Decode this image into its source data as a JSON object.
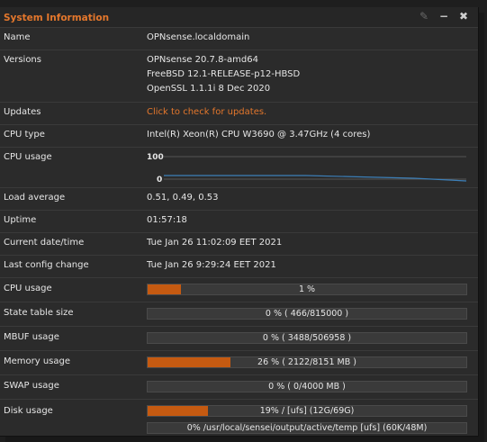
{
  "widget": {
    "title": "System Information"
  },
  "icons": {
    "edit": "pencil-icon",
    "minimize": "minus-icon",
    "close": "close-icon"
  },
  "rows": {
    "name": {
      "label": "Name",
      "value": "OPNsense.localdomain"
    },
    "versions": {
      "label": "Versions",
      "lines": [
        "OPNsense 20.7.8-amd64",
        "FreeBSD 12.1-RELEASE-p12-HBSD",
        "OpenSSL 1.1.1i 8 Dec 2020"
      ]
    },
    "updates": {
      "label": "Updates",
      "link": "Click to check for updates."
    },
    "cpu_type": {
      "label": "CPU type",
      "value": "Intel(R) Xeon(R) CPU W3690 @ 3.47GHz (4 cores)"
    },
    "cpu_graph": {
      "label": "CPU usage",
      "y_max": "100",
      "y_min": "0"
    },
    "load": {
      "label": "Load average",
      "value": "0.51, 0.49, 0.53"
    },
    "uptime": {
      "label": "Uptime",
      "value": "01:57:18"
    },
    "date": {
      "label": "Current date/time",
      "value": "Tue Jan 26 11:02:09 EET 2021"
    },
    "config": {
      "label": "Last config change",
      "value": "Tue Jan 26 9:29:24 EET 2021"
    }
  },
  "bars": {
    "cpu": {
      "label": "CPU usage",
      "text": "1 %",
      "fraction": 0.105
    },
    "state": {
      "label": "State table size",
      "text": "0 % ( 466/815000 )",
      "fraction": 0.0
    },
    "mbuf": {
      "label": "MBUF usage",
      "text": "0 % ( 3488/506958 )",
      "fraction": 0.0
    },
    "memory": {
      "label": "Memory usage",
      "text": "26 % ( 2122/8151 MB )",
      "fraction": 0.26
    },
    "swap": {
      "label": "SWAP usage",
      "text": "0 % ( 0/4000 MB )",
      "fraction": 0.0
    },
    "disk": {
      "label": "Disk usage",
      "text": "19% / [ufs] (12G/69G)",
      "fraction": 0.19
    },
    "disk2": {
      "text": "0% /usr/local/sensei/output/active/temp [ufs] (60K/48M)",
      "fraction": 0.0
    }
  },
  "colors": {
    "accent": "#e4772c",
    "bar_fill": "#c55a11",
    "graph_line": "#3c7fb8"
  }
}
